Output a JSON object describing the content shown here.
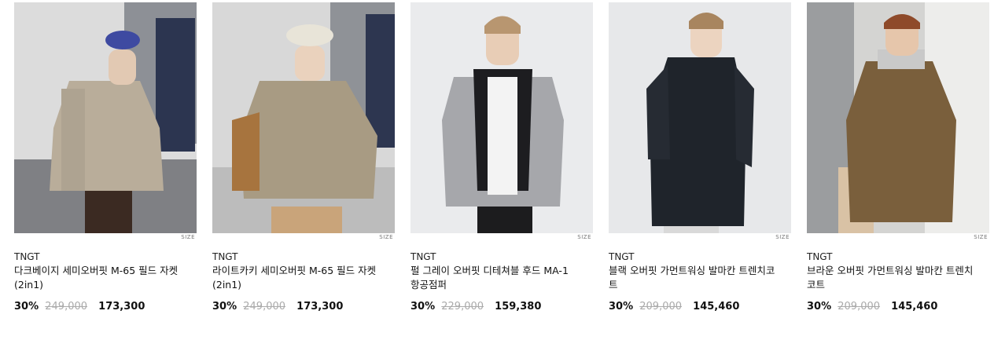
{
  "products": [
    {
      "brand": "TNGT",
      "name": "다크베이지 세미오버핏 M-65 필드 자켓 (2in1)",
      "discount": "30%",
      "original_price": "249,000",
      "sale_price": "173,300",
      "size_tag": "SIZE",
      "bg_color": "#d9d9d9",
      "garment_color": "#b9ad9a"
    },
    {
      "brand": "TNGT",
      "name": "라이트카키 세미오버핏 M-65 필드 자켓 (2in1)",
      "discount": "30%",
      "original_price": "249,000",
      "sale_price": "173,300",
      "size_tag": "SIZE",
      "bg_color": "#d6d6d6",
      "garment_color": "#a89b83"
    },
    {
      "brand": "TNGT",
      "name": "펄 그레이 오버핏 디테쳐블 후드 MA-1 항공점퍼",
      "discount": "30%",
      "original_price": "229,000",
      "sale_price": "159,380",
      "size_tag": "SIZE",
      "bg_color": "#e9eaec",
      "garment_color": "#a6a7ab"
    },
    {
      "brand": "TNGT",
      "name": "블랙 오버핏 가먼트워싱 발마칸 트렌치코트",
      "discount": "30%",
      "original_price": "209,000",
      "sale_price": "145,460",
      "size_tag": "SIZE",
      "bg_color": "#e6e7e9",
      "garment_color": "#1f242b"
    },
    {
      "brand": "TNGT",
      "name": "브라운 오버핏 가먼트워싱 발마칸 트렌치코트",
      "discount": "30%",
      "original_price": "209,000",
      "sale_price": "145,460",
      "size_tag": "SIZE",
      "bg_color": "#d2d2d0",
      "garment_color": "#7a5f3c"
    }
  ]
}
